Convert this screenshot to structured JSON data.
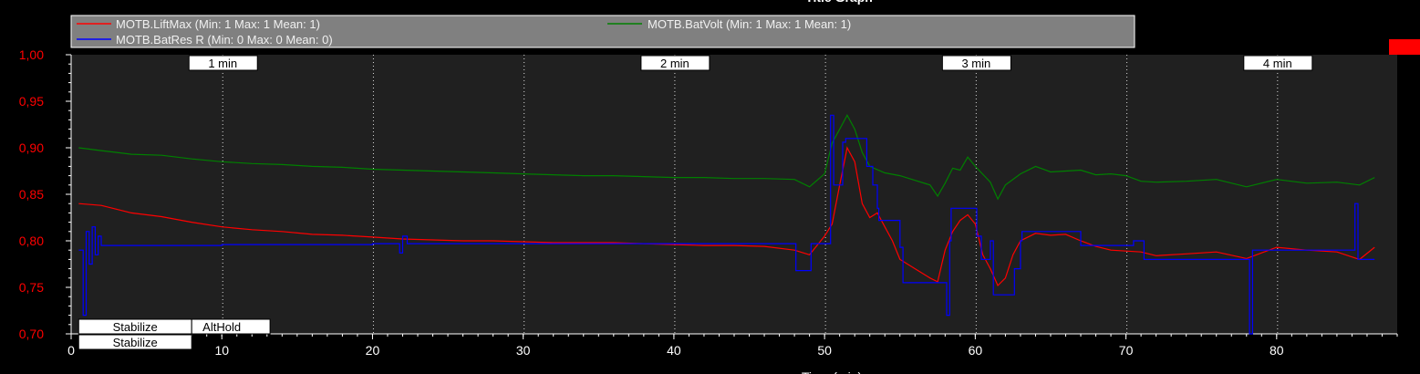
{
  "chart_data": {
    "type": "line",
    "title": "Title Graph",
    "xlabel": "Time (min)",
    "xlim": [
      0,
      88
    ],
    "ylim": [
      0.7,
      1.0
    ],
    "x_ticks": [
      0,
      10,
      20,
      30,
      40,
      50,
      60,
      70,
      80
    ],
    "y_ticks": [
      "1,00",
      "0,95",
      "0,90",
      "0,85",
      "0,80",
      "0,75",
      "0,70"
    ],
    "y_tick_values": [
      1.0,
      0.95,
      0.9,
      0.85,
      0.8,
      0.75,
      0.7
    ],
    "grid": "dotted vertical lines at each minute marker",
    "minute_markers": [
      {
        "x": 10,
        "label": "1 min"
      },
      {
        "x": 20,
        "label": ""
      },
      {
        "x": 30,
        "label": ""
      },
      {
        "x": 40,
        "label": "2 min"
      },
      {
        "x": 50,
        "label": ""
      },
      {
        "x": 60,
        "label": "3 min"
      },
      {
        "x": 70,
        "label": ""
      },
      {
        "x": 80,
        "label": "4 min"
      }
    ],
    "legend": {
      "placement": "top",
      "entries": [
        {
          "name": "MOTB.LiftMax",
          "text": "MOTB.LiftMax (Min: 1 Max: 1 Mean: 1)",
          "color": "#ff0000"
        },
        {
          "name": "MOTB.BatRes R",
          "text": "MOTB.BatRes R (Min: 0 Max: 0 Mean: 0)",
          "color": "#0000ff"
        },
        {
          "name": "MOTB.BatVolt",
          "text": "MOTB.BatVolt (Min: 1 Max: 1 Mean: 1)",
          "color": "#008000"
        }
      ]
    },
    "mode_bands": [
      {
        "label": "Stabilize",
        "x_start": 0.5,
        "x_end": 8,
        "row": 1
      },
      {
        "label": "AltHold",
        "x_start": 8,
        "x_end": 13.2,
        "row": 1
      },
      {
        "label": "Stabilize",
        "x_start": 0.5,
        "x_end": 8,
        "row": 2
      }
    ],
    "series": [
      {
        "name": "MOTB.BatVolt",
        "color": "#008000",
        "x": [
          0.5,
          2,
          4,
          6,
          8,
          10,
          12,
          14,
          16,
          18,
          20,
          22,
          24,
          26,
          28,
          30,
          32,
          34,
          36,
          38,
          40,
          42,
          44,
          46,
          48,
          49,
          50,
          50.5,
          51,
          51.5,
          52,
          52.5,
          53,
          54,
          55,
          56,
          57,
          57.5,
          58,
          58.5,
          59,
          59.5,
          60,
          61,
          61.5,
          62,
          63,
          64,
          65,
          66,
          67,
          68,
          69,
          70,
          71,
          72,
          74,
          76,
          78,
          80,
          82,
          84,
          85.5,
          86.5
        ],
        "y": [
          0.9,
          0.897,
          0.893,
          0.892,
          0.888,
          0.885,
          0.883,
          0.882,
          0.88,
          0.879,
          0.877,
          0.876,
          0.875,
          0.874,
          0.873,
          0.872,
          0.871,
          0.87,
          0.87,
          0.869,
          0.868,
          0.868,
          0.867,
          0.867,
          0.866,
          0.858,
          0.872,
          0.905,
          0.92,
          0.935,
          0.92,
          0.895,
          0.88,
          0.873,
          0.87,
          0.865,
          0.86,
          0.848,
          0.862,
          0.878,
          0.876,
          0.89,
          0.88,
          0.863,
          0.845,
          0.86,
          0.872,
          0.88,
          0.874,
          0.875,
          0.876,
          0.871,
          0.872,
          0.87,
          0.864,
          0.863,
          0.864,
          0.866,
          0.858,
          0.866,
          0.862,
          0.863,
          0.86,
          0.868
        ]
      },
      {
        "name": "MOTB.LiftMax",
        "color": "#ff0000",
        "x": [
          0.5,
          2,
          3,
          4,
          6,
          8,
          10,
          12,
          14,
          16,
          18,
          20,
          22,
          24,
          26,
          28,
          30,
          32,
          34,
          36,
          38,
          40,
          42,
          44,
          46,
          48,
          49,
          50,
          50.5,
          51,
          51.5,
          52,
          52.5,
          53,
          53.5,
          54,
          54.5,
          55,
          56,
          57,
          57.5,
          58,
          58.5,
          59,
          59.5,
          60,
          60.5,
          61,
          61.5,
          62,
          62.5,
          63,
          64,
          65,
          66,
          67,
          68,
          69,
          70,
          71,
          72,
          74,
          76,
          78,
          80,
          82,
          84,
          85.5,
          86.5
        ],
        "y": [
          0.84,
          0.838,
          0.834,
          0.83,
          0.826,
          0.82,
          0.815,
          0.812,
          0.81,
          0.807,
          0.806,
          0.804,
          0.802,
          0.801,
          0.8,
          0.8,
          0.799,
          0.798,
          0.798,
          0.798,
          0.797,
          0.796,
          0.795,
          0.795,
          0.794,
          0.79,
          0.785,
          0.805,
          0.818,
          0.86,
          0.9,
          0.885,
          0.84,
          0.825,
          0.83,
          0.815,
          0.8,
          0.78,
          0.77,
          0.76,
          0.756,
          0.79,
          0.81,
          0.822,
          0.828,
          0.818,
          0.785,
          0.77,
          0.752,
          0.76,
          0.785,
          0.8,
          0.808,
          0.806,
          0.807,
          0.8,
          0.794,
          0.79,
          0.789,
          0.788,
          0.784,
          0.786,
          0.788,
          0.781,
          0.793,
          0.79,
          0.788,
          0.78,
          0.793
        ]
      },
      {
        "name": "MOTB.BatRes R",
        "color": "#0000ff",
        "x": [
          0.5,
          0.8,
          1.0,
          1.2,
          1.4,
          1.6,
          1.8,
          2.0,
          10,
          20,
          21.5,
          21.8,
          22.0,
          22.3,
          30,
          40,
          48,
          48.1,
          49,
          49.1,
          50,
          50.4,
          50.6,
          51.2,
          51.4,
          52.6,
          52.8,
          53.2,
          53.5,
          53.6,
          54.8,
          55,
          55.2,
          57.8,
          58.1,
          58.3,
          58.4,
          58.5,
          60,
          60.1,
          60.4,
          61,
          61.2,
          62.5,
          62.6,
          63.0,
          63.1,
          64,
          66.8,
          67,
          69,
          70.5,
          71,
          71.2,
          72,
          78,
          78.2,
          78.4,
          80,
          84,
          85,
          85.2,
          85.4,
          86.5
        ],
        "y": [
          0.79,
          0.72,
          0.81,
          0.775,
          0.815,
          0.785,
          0.805,
          0.795,
          0.796,
          0.797,
          0.797,
          0.787,
          0.805,
          0.797,
          0.797,
          0.797,
          0.797,
          0.768,
          0.768,
          0.797,
          0.797,
          0.935,
          0.86,
          0.906,
          0.91,
          0.91,
          0.88,
          0.86,
          0.835,
          0.822,
          0.822,
          0.793,
          0.755,
          0.755,
          0.72,
          0.8,
          0.835,
          0.835,
          0.835,
          0.805,
          0.78,
          0.8,
          0.742,
          0.742,
          0.77,
          0.8,
          0.81,
          0.81,
          0.81,
          0.795,
          0.795,
          0.8,
          0.8,
          0.78,
          0.78,
          0.78,
          0.7,
          0.79,
          0.79,
          0.79,
          0.79,
          0.84,
          0.78,
          0.78
        ]
      }
    ]
  }
}
